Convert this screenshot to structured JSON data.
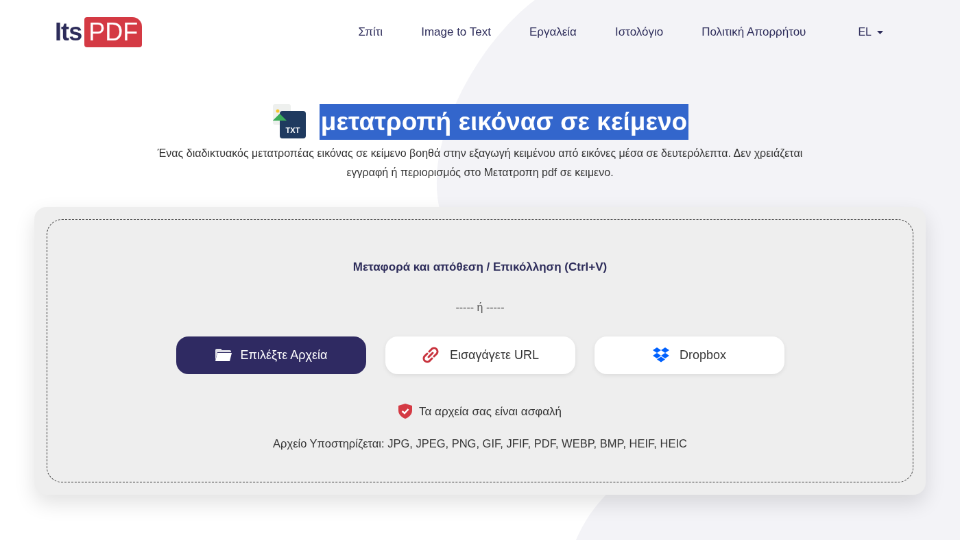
{
  "logo": {
    "part_1": "Its",
    "part_2": "PDF"
  },
  "nav": [
    {
      "label": "Σπίτι"
    },
    {
      "label": "Image to Text"
    },
    {
      "label": "Εργαλεία"
    },
    {
      "label": "Ιστολόγιο"
    },
    {
      "label": "Πολιτική Απορρήτου"
    }
  ],
  "language": "EL",
  "hero": {
    "icon_label": "TXT",
    "title": "μετατροπή εικόνασ σε κείμενο",
    "title_highlighted": true,
    "description": "Ένας διαδικτυακός μετατροπέας εικόνας σε κείμενο βοηθά στην εξαγωγή κειμένου από εικόνες μέσα σε δευτερόλεπτα. Δεν χρειάζεται εγγραφή ή περιορισμός στο Μετατροπη pdf σε κειμενο."
  },
  "upload": {
    "drop_hint": "Μεταφορά και απόθεση / Επικόλληση (Ctrl+V)",
    "separator": "----- ή -----",
    "buttons": [
      {
        "label": "Επιλέξτε Αρχεία",
        "kind": "files"
      },
      {
        "label": "Εισαγάγετε URL",
        "kind": "url"
      },
      {
        "label": "Dropbox",
        "kind": "dropbox"
      }
    ],
    "security_note": "Τα αρχεία σας είναι ασφαλή",
    "supported_formats": "Αρχείο Υποστηρίζεται: JPG, JPEG, PNG, GIF, JFIF, PDF, WEBP, BMP, HEIF, HEIC"
  }
}
